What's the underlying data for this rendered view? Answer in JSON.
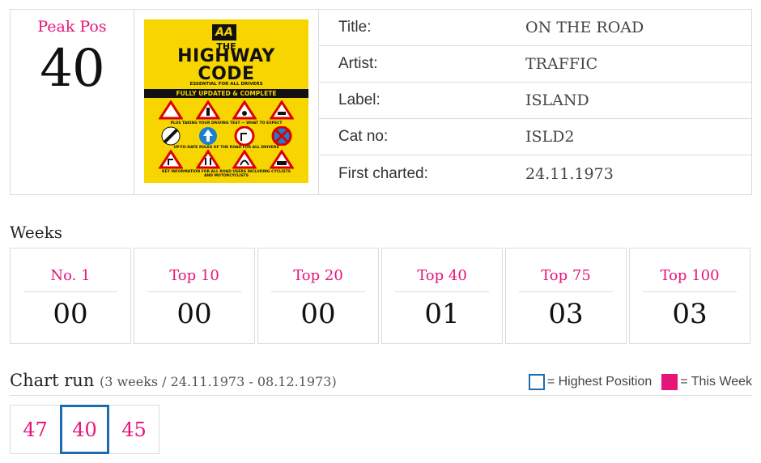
{
  "peak": {
    "label": "Peak Pos",
    "value": "40"
  },
  "cover": {
    "brand": "AA",
    "the": "THE",
    "title_line1": "HIGHWAY",
    "title_line2": "CODE",
    "essential": "ESSENTIAL FOR ALL DRIVERS",
    "band": "FULLY UPDATED & COMPLETE",
    "line1": "PLUS TAKING YOUR DRIVING TEST — WHAT TO EXPECT",
    "line2": "UP-TO-DATE RULES OF THE ROAD FOR ALL DRIVERS",
    "line3": "KEY INFORMATION FOR ALL ROAD USERS INCLUDING CYCLISTS AND MOTORCYCLISTS"
  },
  "details": [
    {
      "label": "Title:",
      "value": "ON THE ROAD"
    },
    {
      "label": "Artist:",
      "value": "TRAFFIC"
    },
    {
      "label": "Label:",
      "value": "ISLAND"
    },
    {
      "label": "Cat no:",
      "value": "ISLD2"
    },
    {
      "label": "First charted:",
      "value": "24.11.1973"
    }
  ],
  "weeks": {
    "title": "Weeks",
    "items": [
      {
        "label": "No. 1",
        "value": "00"
      },
      {
        "label": "Top 10",
        "value": "00"
      },
      {
        "label": "Top 20",
        "value": "00"
      },
      {
        "label": "Top 40",
        "value": "01"
      },
      {
        "label": "Top 75",
        "value": "03"
      },
      {
        "label": "Top 100",
        "value": "03"
      }
    ]
  },
  "chart_run": {
    "title": "Chart run",
    "subtitle": "(3 weeks / 24.11.1973 - 08.12.1973)",
    "legend_highest": "= Highest Position",
    "legend_this_week": "= This Week",
    "positions": [
      "47",
      "40",
      "45"
    ]
  },
  "colors": {
    "accent": "#e6157a",
    "highlight": "#1c6db0",
    "cover_yellow": "#f7d500"
  }
}
